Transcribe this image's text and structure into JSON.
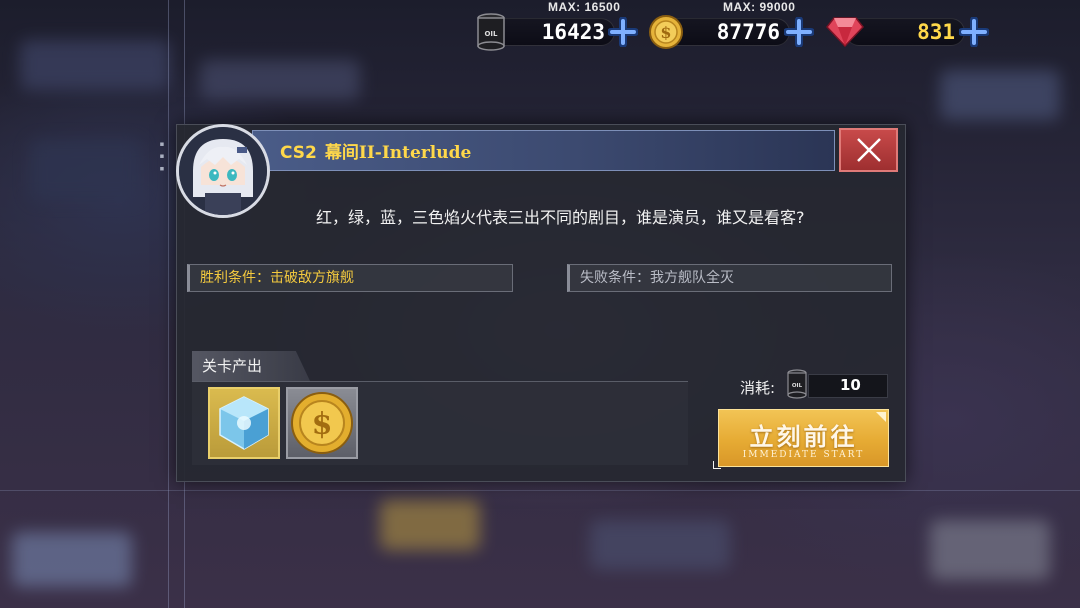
{
  "resources": {
    "oil": {
      "value": "16423",
      "max_label": "MAX: 16500"
    },
    "gold": {
      "value": "87776",
      "max_label": "MAX: 99000"
    },
    "gems": {
      "value": "831"
    }
  },
  "colors": {
    "title": "#ffd84a",
    "gems_value": "#ffd84a",
    "win_condition": "#f3c93e",
    "close_button": "#b83e3f",
    "start_button": "#e6ab34"
  },
  "icons": {
    "resources": [
      "oil-barrel-icon",
      "gold-coin-icon",
      "gem-icon",
      "plus-icon"
    ],
    "close": "close-icon",
    "rewards": [
      "blue-cube-icon",
      "gold-coin-icon"
    ]
  },
  "stage": {
    "code": "CS2",
    "title": "幕间II-Interlude",
    "description": "红，绿，蓝，三色焰火代表三出不同的剧目，谁是演员，谁又是看客?",
    "win_condition": "胜利条件：击破敌方旗舰",
    "lose_condition": "失败条件：我方舰队全灭",
    "output_label": "关卡产出",
    "cost_label": "消耗:",
    "cost_value": "10",
    "start_label": "立刻前往",
    "start_sublabel": "IMMEDIATE START"
  }
}
